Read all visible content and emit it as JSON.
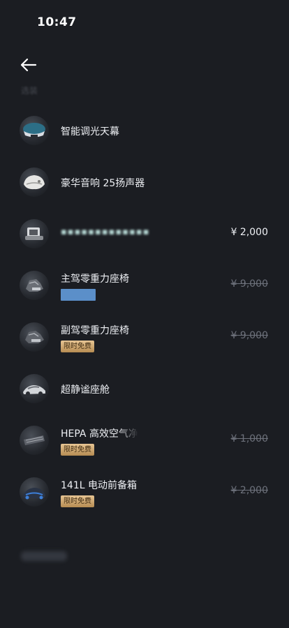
{
  "status_bar": {
    "time": "10:47"
  },
  "section_label": "选装",
  "features": [
    {
      "name": "智能调光天幕",
      "badge": null,
      "price": "",
      "icon": "glass-roof-icon"
    },
    {
      "name": "豪华音响 25扬声器",
      "badge": null,
      "price": "",
      "icon": "speaker-icon"
    },
    {
      "name": "▪▪▪▪▪▪▪▪▪▪▪▪▪",
      "badge": null,
      "price": "¥ 2,000",
      "icon": "console-icon"
    },
    {
      "name": "主驾零重力座椅",
      "badge": null,
      "price": "¥ 9,000",
      "icon": "seat-icon"
    },
    {
      "name": "副驾零重力座椅",
      "badge": "限时免费",
      "price": "¥ 9,000",
      "icon": "seat-icon"
    },
    {
      "name": "超静谧座舱",
      "badge": null,
      "price": "",
      "icon": "car-icon"
    },
    {
      "name": "HEPA 高效空气净",
      "badge": "限时免费",
      "price": "¥ 1,000",
      "icon": "filter-icon"
    },
    {
      "name": "141L 电动前备箱",
      "badge": "限时免费",
      "price": "¥ 2,000",
      "icon": "frunk-icon"
    }
  ],
  "colors": {
    "background": "#1b1d22",
    "badge_gold": "#d1ad75",
    "selected_blue": "#5b8fc9"
  }
}
